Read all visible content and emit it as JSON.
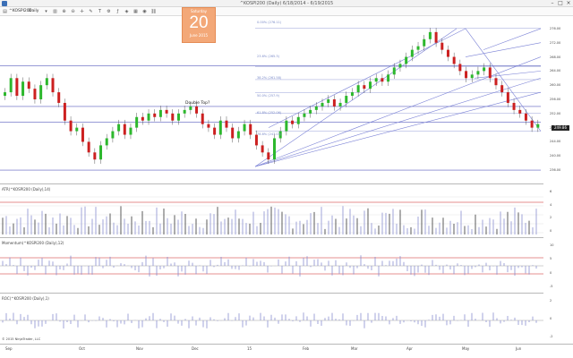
{
  "window": {
    "title": "^KOSPI200 (Daily)  6/18/2014 - 6/19/2015"
  },
  "toolbar": {
    "symbol": "^KOSPI200",
    "interval": "Daily"
  },
  "date_badge": {
    "day_of_week": "Saturday",
    "day": "20",
    "month_year": "June 2015"
  },
  "price_pane": {
    "annotation": "Double Top?",
    "fib_labels": [
      "0.00% (276.11)",
      "23.6% (265.3)",
      "38.2% (261.58)",
      "50.0% (257.9)",
      "61.8% (252.06)",
      "78.6% (247.03)"
    ],
    "last_price": "249.86"
  },
  "indicators": {
    "atr": "ATR(^KOSPI200 (Daily),14)",
    "momentum": "Momentum(^KOSPI200 (Daily),12)",
    "roc": "ROC(^KOSPI200 (Daily),1)"
  },
  "x_axis": [
    "Sep",
    "Oct",
    "Nov",
    "Dec",
    "15",
    "Feb",
    "Mar",
    "Apr",
    "May",
    "Jun"
  ],
  "footer": {
    "copyright": "© 2015 NinjaTrader, LLC"
  },
  "chart_data": {
    "type": "candlestick",
    "title": "^KOSPI200 (Daily)  6/18/2014 - 6/19/2015",
    "y_ticks_price": [
      "276.00",
      "272.00",
      "268.00",
      "264.00",
      "260.00",
      "256.00",
      "252.00",
      "248.00",
      "244.00",
      "240.00",
      "236.00"
    ],
    "ylim": [
      234,
      278
    ],
    "x_categories": [
      "Sep",
      "Oct",
      "Nov",
      "Dec",
      "15",
      "Feb",
      "Mar",
      "Apr",
      "May",
      "Jun"
    ],
    "close_series": [
      258,
      262,
      257,
      261,
      259,
      256,
      260,
      262,
      258,
      255,
      250,
      247,
      248,
      244,
      241,
      239,
      243,
      245,
      247,
      249,
      246,
      248,
      251,
      250,
      252,
      251,
      253,
      252,
      250,
      252,
      253,
      254,
      252,
      249,
      248,
      246,
      250,
      248,
      245,
      247,
      249,
      246,
      243,
      241,
      239,
      245,
      247,
      250,
      249,
      251,
      252,
      253,
      254,
      255,
      256,
      254,
      255,
      257,
      258,
      260,
      259,
      261,
      262,
      261,
      263,
      265,
      266,
      268,
      270,
      271,
      273,
      275,
      272,
      270,
      268,
      266,
      264,
      262,
      263,
      264,
      265,
      262,
      260,
      258,
      255,
      253,
      252,
      250,
      248,
      249
    ],
    "ytick_labels_atr": [
      "6",
      "4",
      "2",
      "0"
    ],
    "ytick_labels_momentum": [
      "10",
      "5",
      "0",
      "-5"
    ],
    "ytick_labels_roc": [
      "2",
      "0",
      "-2"
    ],
    "bullish_color": "#2db82d",
    "bearish_color": "#cc2020",
    "trendline_color": "#7b82d6",
    "hline_color": "#5a5fbf"
  }
}
